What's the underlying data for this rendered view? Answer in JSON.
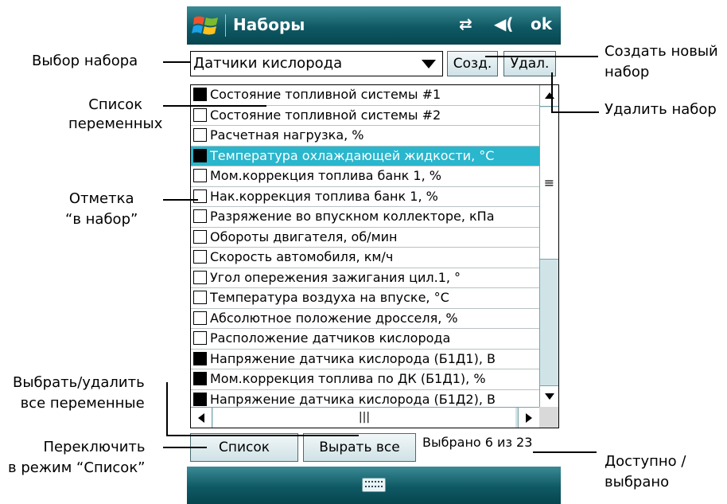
{
  "window": {
    "title": "Наборы",
    "ok_label": "ok",
    "icons": [
      "windows-logo-icon",
      "connection-icon",
      "volume-icon"
    ]
  },
  "set_selector": {
    "value": "Датчики кислорода"
  },
  "buttons": {
    "create": "Созд.",
    "delete": "Удал.",
    "list": "Список",
    "select_all": "Вырать все"
  },
  "variables": [
    {
      "label": "Состояние топливной системы #1",
      "checked": true
    },
    {
      "label": "Состояние топливной системы #2",
      "checked": false
    },
    {
      "label": "Расчетная нагрузка, %",
      "checked": false
    },
    {
      "label": "Температура охлаждающей жидкости, °C",
      "checked": true,
      "selected": true
    },
    {
      "label": "Мом.коррекция топлива банк 1, %",
      "checked": false
    },
    {
      "label": "Нак.коррекция топлива банк 1, %",
      "checked": false
    },
    {
      "label": "Разряжение во впускном коллекторе, кПа",
      "checked": false
    },
    {
      "label": "Обороты двигателя, об/мин",
      "checked": false
    },
    {
      "label": "Скорость автомобиля, км/ч",
      "checked": false
    },
    {
      "label": "Угол опережения зажигания цил.1, °",
      "checked": false
    },
    {
      "label": "Температура воздуха на впуске, °C",
      "checked": false
    },
    {
      "label": "Абсолютное положение дросселя, %",
      "checked": false
    },
    {
      "label": "Расположение датчиков кислорода",
      "checked": false
    },
    {
      "label": "Напряжение датчика кислорода (Б1Д1), В",
      "checked": true
    },
    {
      "label": "Мом.коррекция топлива по ДК (Б1Д1), %",
      "checked": true
    },
    {
      "label": "Напряжение датчика кислорода (Б1Д2), В",
      "checked": true
    }
  ],
  "status": {
    "text": "Выбрано 6 из 23"
  },
  "annotations": {
    "select_set": "Выбор набора",
    "create_set": "Создать новый\nнабор",
    "delete_set": "Удалить набор",
    "variable_list": "Список\nпеременных",
    "mark": "Отметка\n“в набор”",
    "select_all": "Выбрать/удалить\nвсе переменные",
    "switch_mode": "Переключить\nв режим “Список”",
    "available": "Доступно /\nвыбрано"
  },
  "colors": {
    "titlebar": "#0f5964",
    "selection": "#2ab6cd",
    "scrollbar": "#d0e4e7"
  }
}
